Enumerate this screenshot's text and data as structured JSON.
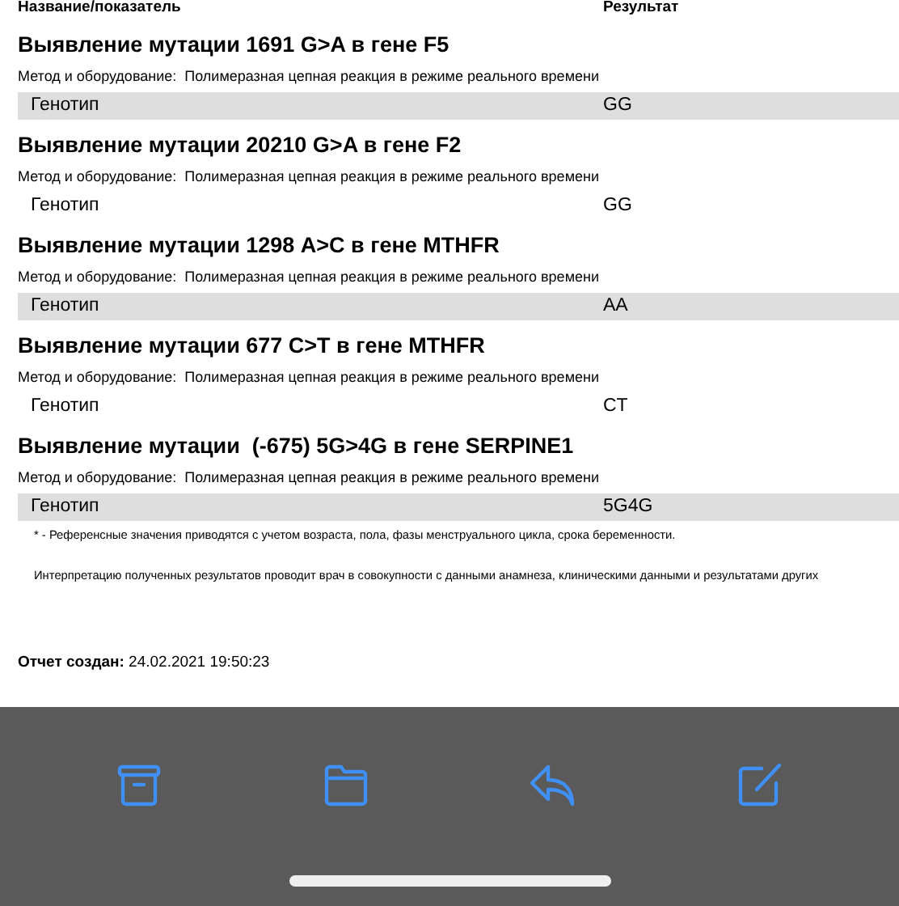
{
  "table": {
    "columns": [
      "Название/показатель",
      "Результат"
    ],
    "tests": [
      {
        "title": "Выявление мутации 1691 G>A в гене F5",
        "method_label": "Метод и оборудование:",
        "method": "Полимеразная цепная реакция в режиме реального времени",
        "row": {
          "name": "Генотип",
          "result": "GG"
        }
      },
      {
        "title": "Выявление мутации 20210 G>A в гене F2",
        "method_label": "Метод и оборудование:",
        "method": "Полимеразная цепная реакция в режиме реального времени",
        "row": {
          "name": "Генотип",
          "result": "GG"
        }
      },
      {
        "title": "Выявление мутации 1298 A>C в гене MTHFR",
        "method_label": "Метод и оборудование:",
        "method": "Полимеразная цепная реакция в режиме реального времени",
        "row": {
          "name": "Генотип",
          "result": "AA"
        }
      },
      {
        "title": "Выявление мутации 677 C>T в гене MTHFR",
        "method_label": "Метод и оборудование:",
        "method": "Полимеразная цепная реакция в режиме реального времени",
        "row": {
          "name": "Генотип",
          "result": "CT"
        }
      },
      {
        "title": "Выявление мутации  (-675) 5G>4G в гене SERPINE1",
        "method_label": "Метод и оборудование:",
        "method": "Полимеразная цепная реакция в режиме реального времени",
        "row": {
          "name": "Генотип",
          "result": "5G4G"
        }
      }
    ]
  },
  "notes": [
    "* - Референсные значения приводятся с учетом возраста, пола, фазы менструального цикла, срока беременности.",
    "Интерпретацию полученных результатов проводит врач в совокупности с данными анамнеза, клиническими данными и результатами других"
  ],
  "report_created": {
    "label": "Отчет создан:",
    "value": "24.02.2021 19:50:23"
  },
  "toolbar": [
    {
      "kind": "archive"
    },
    {
      "kind": "folder"
    },
    {
      "kind": "reply"
    },
    {
      "kind": "compose"
    }
  ]
}
